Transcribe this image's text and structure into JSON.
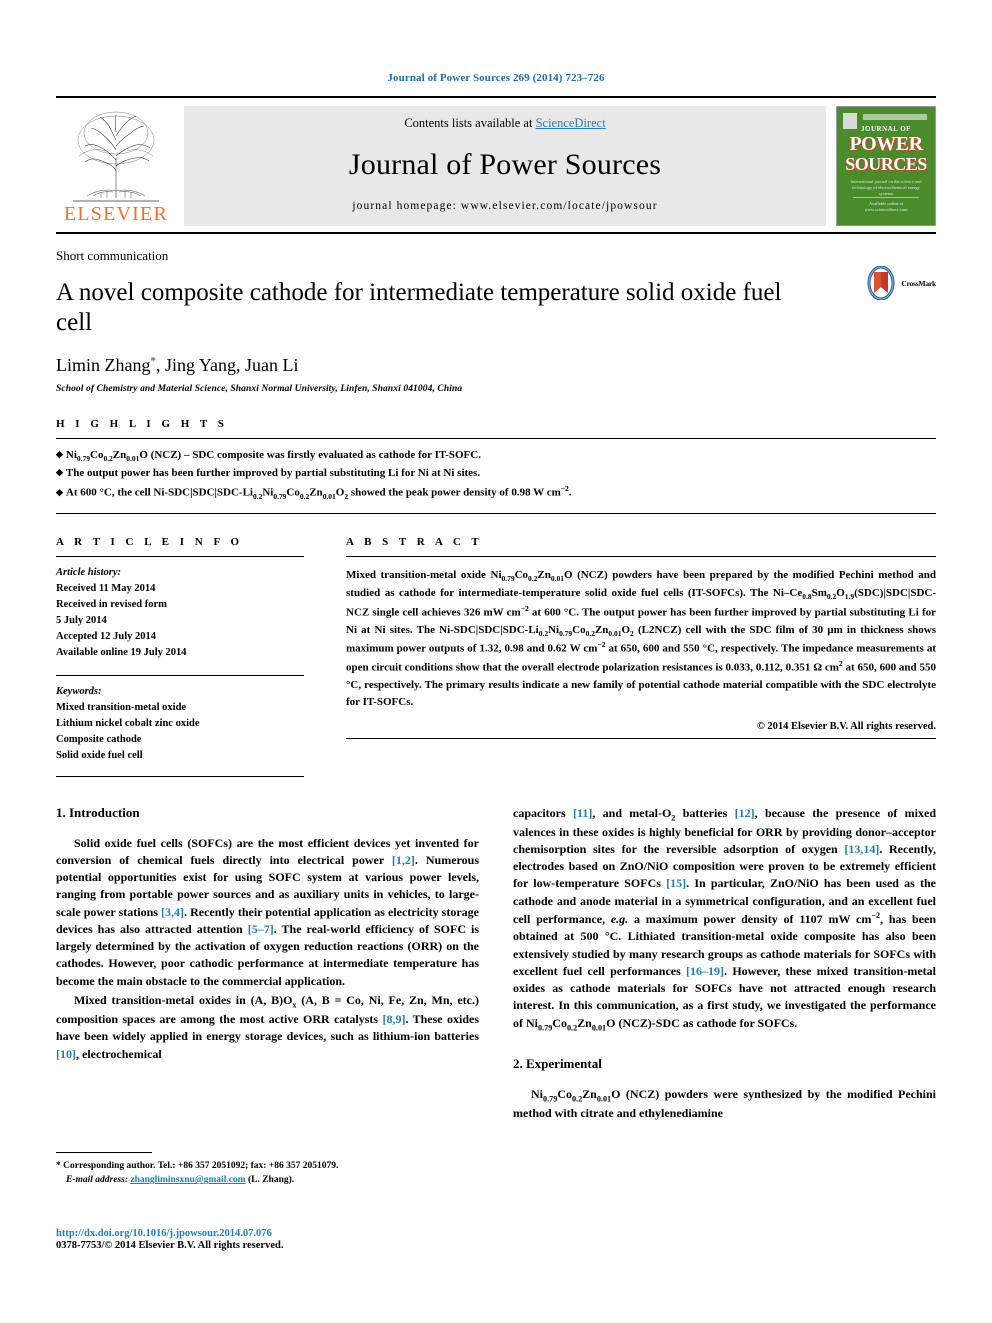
{
  "running_head": "Journal of Power Sources 269 (2014) 723–726",
  "masthead": {
    "publisher": "ELSEVIER",
    "contents_prefix": "Contents lists available at ",
    "contents_link": "ScienceDirect",
    "journal_title": "Journal of Power Sources",
    "homepage": "journal homepage: www.elsevier.com/locate/jpowsour",
    "cover": {
      "journal_of": "JOURNAL OF",
      "power": "POWER",
      "sources": "SOURCES",
      "subtitle": "International journal on the science and technology of electrochemical energy systems",
      "footer": "Available online at www.sciencedirect.com"
    }
  },
  "article": {
    "section_type": "Short communication",
    "title": "A novel composite cathode for intermediate temperature solid oxide fuel cell",
    "authors": "Limin Zhang*, Jing Yang, Juan Li",
    "affiliation": "School of Chemistry and Material Science, Shanxi Normal University, Linfen, Shanxi 041004, China",
    "crossmark_label": "CrossMark"
  },
  "highlights": {
    "heading": "H I G H L I G H T S",
    "items": [
      "Ni0.79Co0.2Zn0.01O (NCZ) – SDC composite was firstly evaluated as cathode for IT-SOFC.",
      "The output power has been further improved by partial substituting Li for Ni at Ni sites.",
      "At 600 °C, the cell Ni-SDC|SDC|SDC-Li0.2Ni0.79Co0.2Zn0.01O2 showed the peak power density of 0.98 W cm−2."
    ]
  },
  "article_info": {
    "heading": "A R T I C L E   I N F O",
    "history_label": "Article history:",
    "history": [
      "Received 11 May 2014",
      "Received in revised form",
      "5 July 2014",
      "Accepted 12 July 2014",
      "Available online 19 July 2014"
    ],
    "keywords_label": "Keywords:",
    "keywords": [
      "Mixed transition-metal oxide",
      "Lithium nickel cobalt zinc oxide",
      "Composite cathode",
      "Solid oxide fuel cell"
    ]
  },
  "abstract": {
    "heading": "A B S T R A C T",
    "copyright": "© 2014 Elsevier B.V. All rights reserved."
  },
  "sections": {
    "introduction_heading": "1. Introduction",
    "experimental_heading": "2. Experimental"
  },
  "footnote": {
    "corresponding": "* Corresponding author. Tel.: +86 357 2051092; fax: +86 357 2051079.",
    "email_label": "E-mail address:",
    "email": "zhangliminsxnu@gmail.com",
    "email_suffix": " (L. Zhang)."
  },
  "footer": {
    "doi": "http://dx.doi.org/10.1016/j.jpowsour.2014.07.076",
    "issn": "0378-7753/© 2014 Elsevier B.V. All rights reserved."
  },
  "colors": {
    "link_blue": "#1f7fb5",
    "running_head_blue": "#1f6fa8",
    "elsevier_orange": "#E8762C",
    "cover_green": "#4a8b2c",
    "band_grey": "#e8e8e8"
  }
}
